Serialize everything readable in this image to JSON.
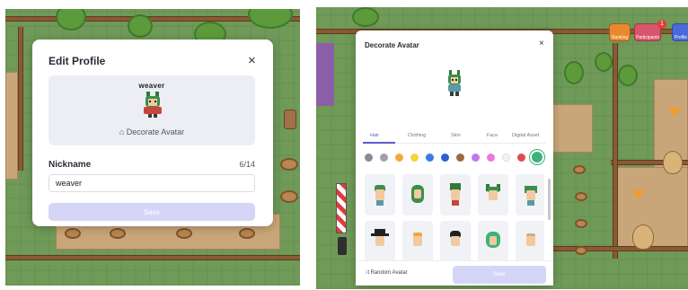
{
  "edit_profile": {
    "title": "Edit Profile",
    "close_label": "×",
    "username_tag": "weaver",
    "decorate_link": "Decorate Avatar",
    "decorate_icon": "shirt-icon",
    "nickname_label": "Nickname",
    "nickname_count": "6/14",
    "nickname_value": "weaver",
    "save_label": "Save"
  },
  "decorate_avatar": {
    "title": "Decorate Avatar",
    "close_label": "×",
    "tabs": [
      "Hair",
      "Clothing",
      "Skin",
      "Face",
      "Digital Asset"
    ],
    "active_tab": "Hair",
    "swatches": [
      "#8a8a96",
      "#a0a0aa",
      "#f2a93b",
      "#f6d23c",
      "#3a7be0",
      "#2f5fd1",
      "#9a6a3e",
      "#c07ae8",
      "#ee7ad6",
      "#f4f4f4",
      "#e24c4c",
      "#3cb37a"
    ],
    "selected_swatch": "#3cb37a",
    "random_label": "Random Avatar",
    "save_label": "Save"
  },
  "hud": {
    "ranking_label": "Ranking",
    "participants_label": "Participants",
    "profile_label": "Profile",
    "notification_count": "1"
  },
  "colors": {
    "accent": "#5b5bd6",
    "save_disabled": "#d5d6f7",
    "grass": "#6f9a58"
  }
}
